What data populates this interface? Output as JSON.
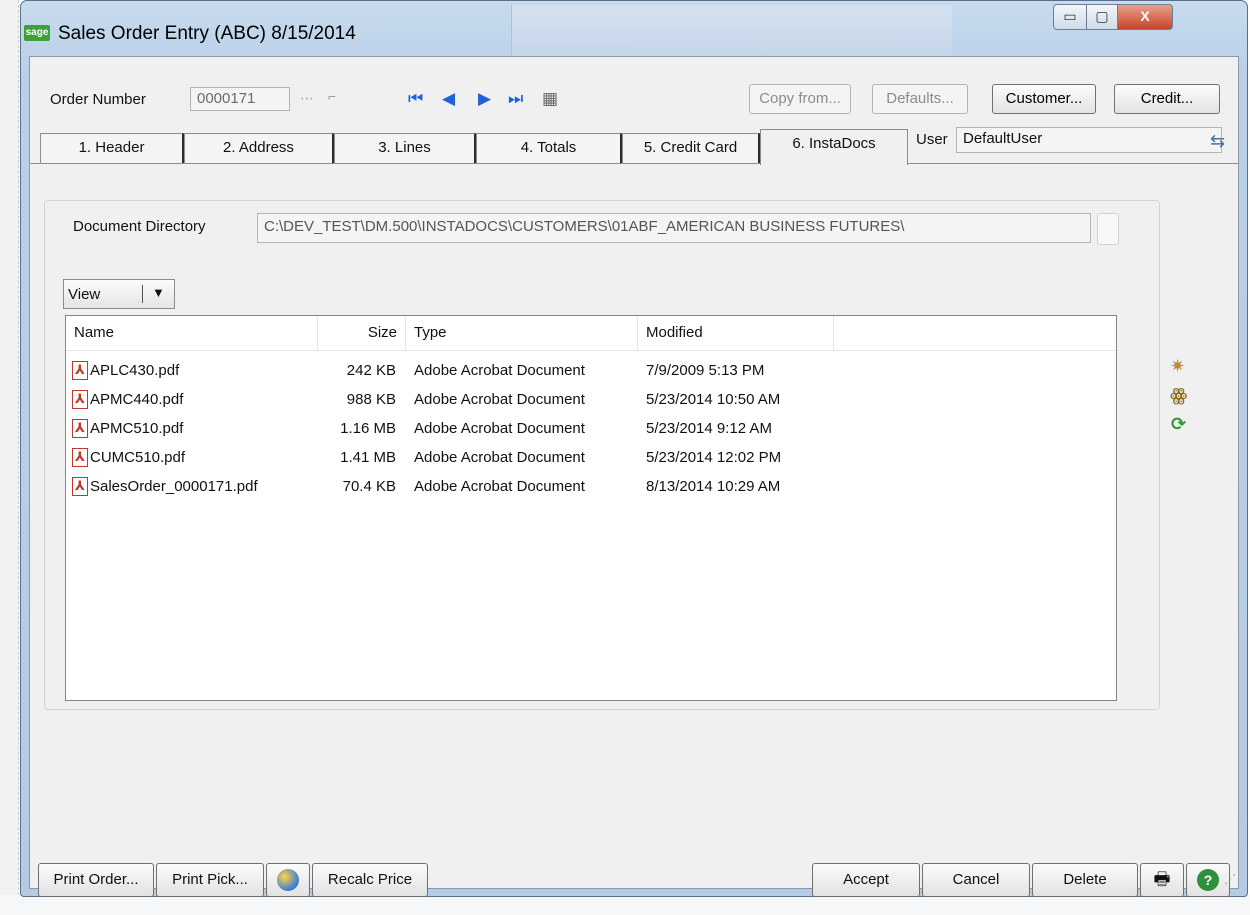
{
  "window": {
    "title": "Sales Order Entry (ABC) 8/15/2014",
    "app_icon_text": "sage",
    "controls": {
      "minimize": "▭",
      "maximize": "▢",
      "close": "X"
    }
  },
  "toolbar": {
    "order_number_label": "Order Number",
    "order_number_value": "0000171",
    "copy_from_label": "Copy from...",
    "defaults_label": "Defaults...",
    "customer_label": "Customer...",
    "credit_label": "Credit..."
  },
  "tabs": [
    {
      "label": "1. Header"
    },
    {
      "label": "2. Address"
    },
    {
      "label": "3. Lines"
    },
    {
      "label": "4. Totals"
    },
    {
      "label": "5. Credit Card"
    },
    {
      "label": "6. InstaDocs"
    }
  ],
  "user": {
    "label": "User",
    "value": "DefaultUser"
  },
  "instadocs": {
    "document_directory_label": "Document Directory",
    "document_directory_value": "C:\\DEV_TEST\\DM.500\\INSTADOCS\\CUSTOMERS\\01ABF_AMERICAN BUSINESS FUTURES\\",
    "view_label": "View",
    "columns": [
      "Name",
      "Size",
      "Type",
      "Modified"
    ],
    "files": [
      {
        "name": "APLC430.pdf",
        "size": "242 KB",
        "type": "Adobe Acrobat Document",
        "modified": "7/9/2009 5:13 PM"
      },
      {
        "name": "APMC440.pdf",
        "size": "988 KB",
        "type": "Adobe Acrobat Document",
        "modified": "5/23/2014 10:50 AM"
      },
      {
        "name": "APMC510.pdf",
        "size": "1.16 MB",
        "type": "Adobe Acrobat Document",
        "modified": "5/23/2014 9:12 AM"
      },
      {
        "name": "CUMC510.pdf",
        "size": "1.41 MB",
        "type": "Adobe Acrobat Document",
        "modified": "5/23/2014 12:02 PM"
      },
      {
        "name": "SalesOrder_0000171.pdf",
        "size": "70.4 KB",
        "type": "Adobe Acrobat Document",
        "modified": "8/13/2014 10:29 AM"
      }
    ]
  },
  "bottom": {
    "print_order_label": "Print Order...",
    "print_pick_label": "Print Pick...",
    "recalc_price_label": "Recalc Price",
    "accept_label": "Accept",
    "cancel_label": "Cancel",
    "delete_label": "Delete"
  },
  "icons": {
    "pdf": "pdf-icon",
    "wand": "magic-wand-icon",
    "find": "binoculars-icon",
    "refresh": "refresh-icon",
    "printer": "printer-icon",
    "help": "help-icon"
  },
  "colors": {
    "nav_arrows": "#1f62d6",
    "refresh": "#2e9a2e",
    "help": "#2f8f3a",
    "pdf": "#c4362c"
  }
}
